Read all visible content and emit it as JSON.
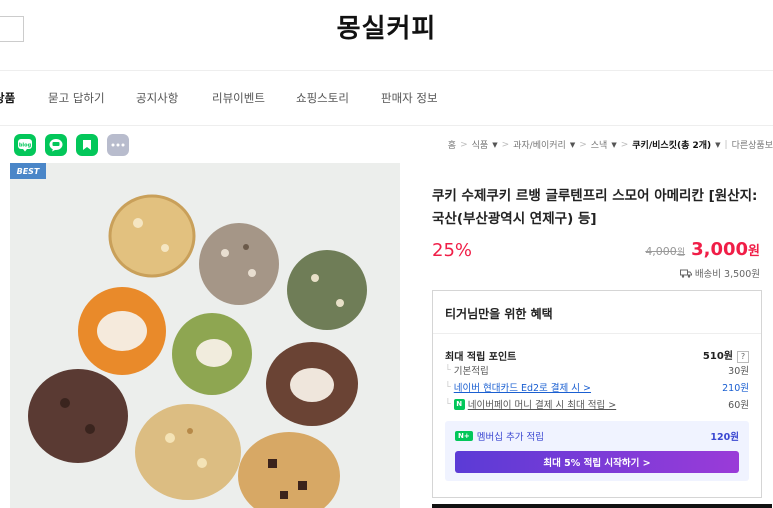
{
  "store": {
    "title": "몽실커피"
  },
  "nav": {
    "items": [
      {
        "label": "상품",
        "active": true
      },
      {
        "label": "묻고 답하기"
      },
      {
        "label": "공지사항"
      },
      {
        "label": "리뷰이벤트"
      },
      {
        "label": "쇼핑스토리"
      },
      {
        "label": "판매자 정보"
      }
    ]
  },
  "share": {
    "icons": [
      "blog-icon",
      "talk-icon",
      "bookmark-icon",
      "more-icon"
    ],
    "colors": {
      "green": "#03c75a",
      "gray": "#b8bccd"
    }
  },
  "breadcrumb": {
    "home": "홈",
    "level1": "식품",
    "level2": "과자/베이커리",
    "level3": "스낵",
    "current": "쿠키/비스킷(총 2개)",
    "other": "다른상품보"
  },
  "product": {
    "badge": "BEST",
    "name": "쿠키 수제쿠키 르뱅 글루텐프리 스모어 아메리칸 [원산지:국산(부산광역시 연제구) 등]",
    "discount": "25%",
    "old_price": "4,000",
    "old_price_unit": "원",
    "price": "3,000",
    "price_unit": "원",
    "shipping": "배송비 3,500원",
    "accent_color": "#f01e47"
  },
  "benefit": {
    "title": "티거님만을 위한 혜택",
    "max_points_label": "최대 적립 포인트",
    "max_points_value": "510원",
    "help": "?",
    "rows": [
      {
        "label": "기본적립",
        "value": "30원"
      },
      {
        "label": "네이버 현대카드 Ed2로 결제 시 >",
        "value": "210원"
      },
      {
        "label": "네이버페이 머니 결제 시 최대 적립 >",
        "value": "60원"
      }
    ],
    "membership_label": "멤버십 추가 적립",
    "membership_value": "120원",
    "membership_badge": "N+",
    "npay_badge": "N",
    "cta": "최대 5% 적립 시작하기 >"
  }
}
